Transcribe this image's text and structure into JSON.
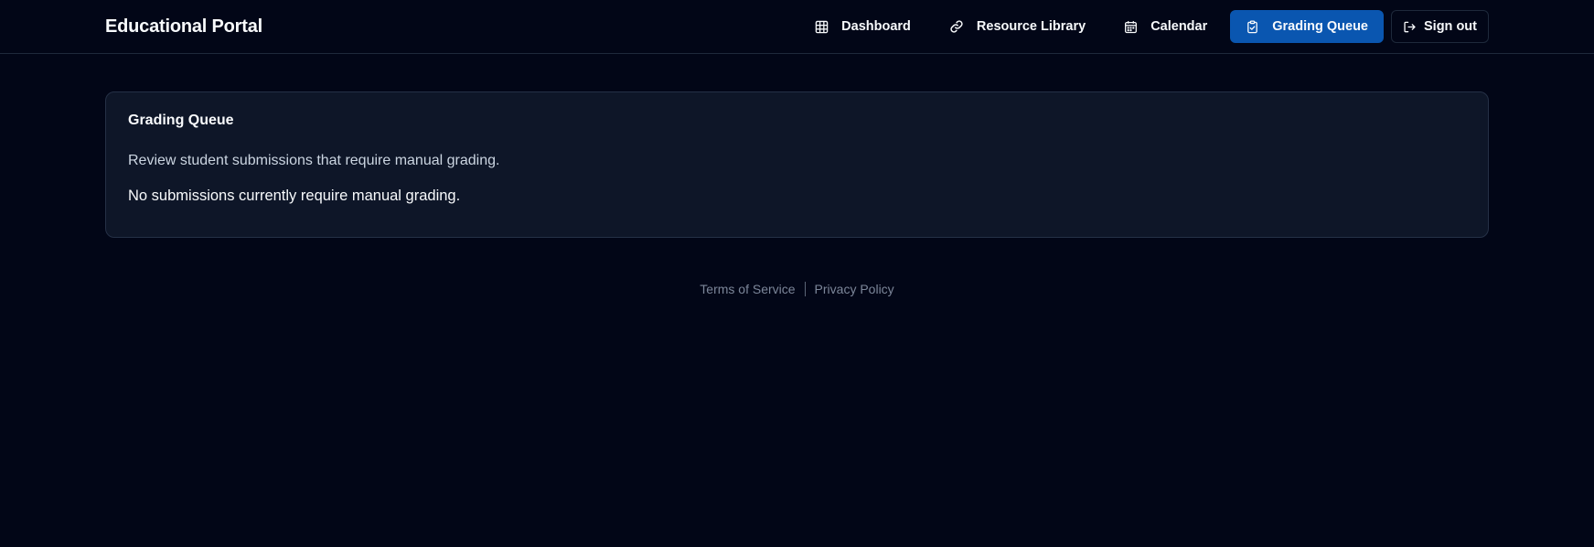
{
  "brand": "Educational Portal",
  "nav": {
    "items": [
      {
        "label": "Dashboard",
        "icon": "grid-icon"
      },
      {
        "label": "Resource Library",
        "icon": "link-icon"
      },
      {
        "label": "Calendar",
        "icon": "calendar-icon"
      },
      {
        "label": "Grading Queue",
        "icon": "clipboard-check-icon",
        "active": true
      }
    ],
    "signout": {
      "label": "Sign out",
      "icon": "sign-out-icon"
    }
  },
  "card": {
    "title": "Grading Queue",
    "description": "Review student submissions that require manual grading.",
    "empty_message": "No submissions currently require manual grading."
  },
  "footer": {
    "terms": "Terms of Service",
    "privacy": "Privacy Policy"
  },
  "colors": {
    "background": "#020617",
    "card": "#0e1628",
    "accent": "#0a56b0",
    "muted": "#7c8699"
  }
}
